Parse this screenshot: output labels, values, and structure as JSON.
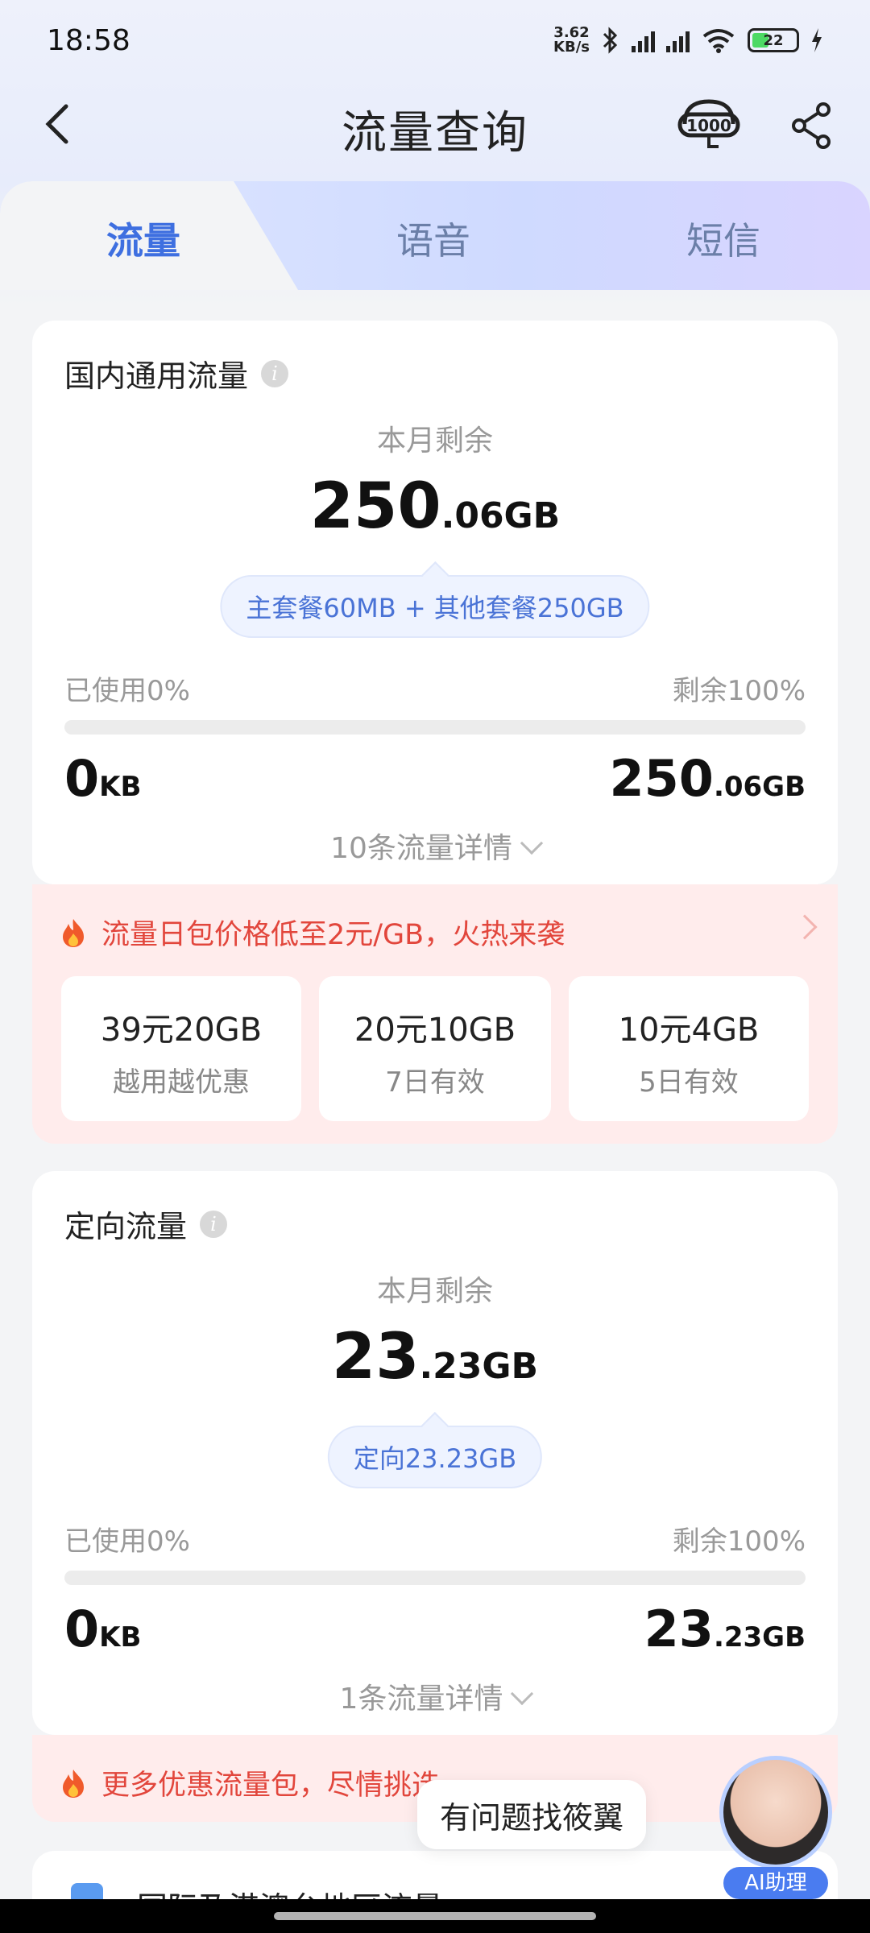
{
  "status_bar": {
    "time": "18:58",
    "net_speed_value": "3.62",
    "net_speed_unit": "KB/s",
    "battery": "22"
  },
  "header": {
    "title": "流量查询"
  },
  "tabs": [
    {
      "label": "流量",
      "active": true
    },
    {
      "label": "语音",
      "active": false
    },
    {
      "label": "短信",
      "active": false
    }
  ],
  "general_flow": {
    "title": "国内通用流量",
    "remain_label": "本月剩余",
    "remain_int": "250",
    "remain_dec": ".06GB",
    "breakdown": "主套餐60MB + 其他套餐250GB",
    "used_label": "已使用0%",
    "rest_label": "剩余100%",
    "used_fraction": 0,
    "used_int": "0",
    "used_unit": "KB",
    "rest_int": "250",
    "rest_dec": ".06GB",
    "details": "10条流量详情"
  },
  "promo1": {
    "text": "流量日包价格低至2元/GB，火热来袭",
    "packages": [
      {
        "main": "39元20GB",
        "sub": "越用越优惠"
      },
      {
        "main": "20元10GB",
        "sub": "7日有效"
      },
      {
        "main": "10元4GB",
        "sub": "5日有效"
      }
    ]
  },
  "directed_flow": {
    "title": "定向流量",
    "remain_label": "本月剩余",
    "remain_int": "23",
    "remain_dec": ".23GB",
    "breakdown": "定向23.23GB",
    "used_label": "已使用0%",
    "rest_label": "剩余100%",
    "used_fraction": 0,
    "used_int": "0",
    "used_unit": "KB",
    "rest_int": "23",
    "rest_dec": ".23GB",
    "details": "1条流量详情"
  },
  "promo2": {
    "text": "更多优惠流量包，尽情挑选"
  },
  "bottom_card": {
    "title": "国际及港澳台地区流量"
  },
  "assistant": {
    "tooltip": "有问题找筱翼",
    "label": "AI助理"
  },
  "colors": {
    "accent": "#3e6fe0",
    "promo_text": "#e2463c",
    "promo_bg": "#ffecec"
  }
}
